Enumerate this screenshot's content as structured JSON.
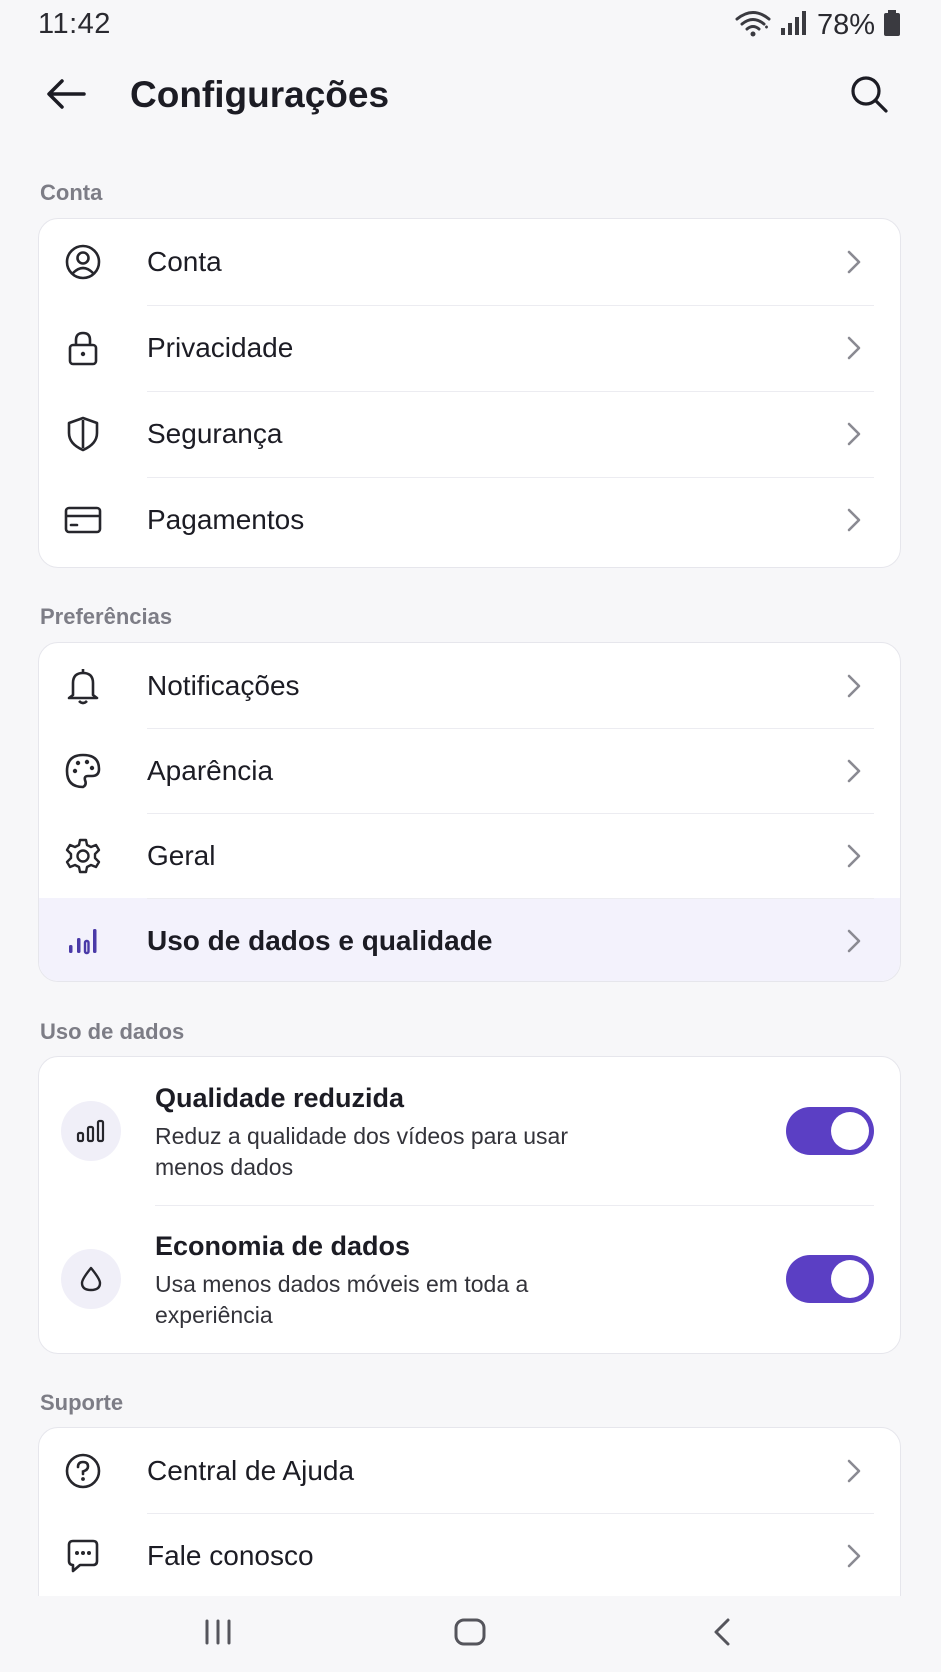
{
  "status_bar": {
    "time": "11:42",
    "battery": "78%",
    "icons": [
      "wifi-icon",
      "signal-icon",
      "battery-icon"
    ]
  },
  "app_bar": {
    "title": "Configurações",
    "back_icon": "arrow-left-icon",
    "search_icon": "search-icon"
  },
  "sections": {
    "account": {
      "header": "Conta",
      "items": [
        {
          "label": "Conta",
          "icon": "user-circle-icon"
        },
        {
          "label": "Privacidade",
          "icon": "lock-icon"
        },
        {
          "label": "Segurança",
          "icon": "shield-icon"
        },
        {
          "label": "Pagamentos",
          "icon": "credit-card-icon"
        }
      ]
    },
    "preferences": {
      "header": "Preferências",
      "items": [
        {
          "label": "Notificações",
          "icon": "bell-icon"
        },
        {
          "label": "Aparência",
          "icon": "palette-icon"
        },
        {
          "label": "Geral",
          "icon": "gear-icon"
        },
        {
          "label": "Uso de dados e qualidade",
          "icon": "data-bars-icon",
          "selected": true
        }
      ]
    },
    "data_usage": {
      "header": "Uso de dados",
      "toggles": [
        {
          "title": "Qualidade reduzida",
          "description": "Reduz a qualidade dos vídeos para usar menos dados",
          "on": true,
          "icon": "bars-icon"
        },
        {
          "title": "Economia de dados",
          "description": "Usa menos dados móveis em toda a experiência",
          "on": true,
          "icon": "droplet-icon"
        }
      ]
    },
    "support": {
      "header": "Suporte",
      "items": [
        {
          "label": "Central de Ajuda",
          "icon": "help-circle-icon"
        },
        {
          "label": "Fale conosco",
          "icon": "chat-icon"
        }
      ]
    }
  },
  "colors": {
    "accent": "#5b3fc4",
    "selected_row": "#f3f2fc",
    "background": "#f7f7f9"
  },
  "nav_bar": {
    "icons": [
      "recent-apps-icon",
      "home-icon",
      "back-nav-icon"
    ]
  }
}
